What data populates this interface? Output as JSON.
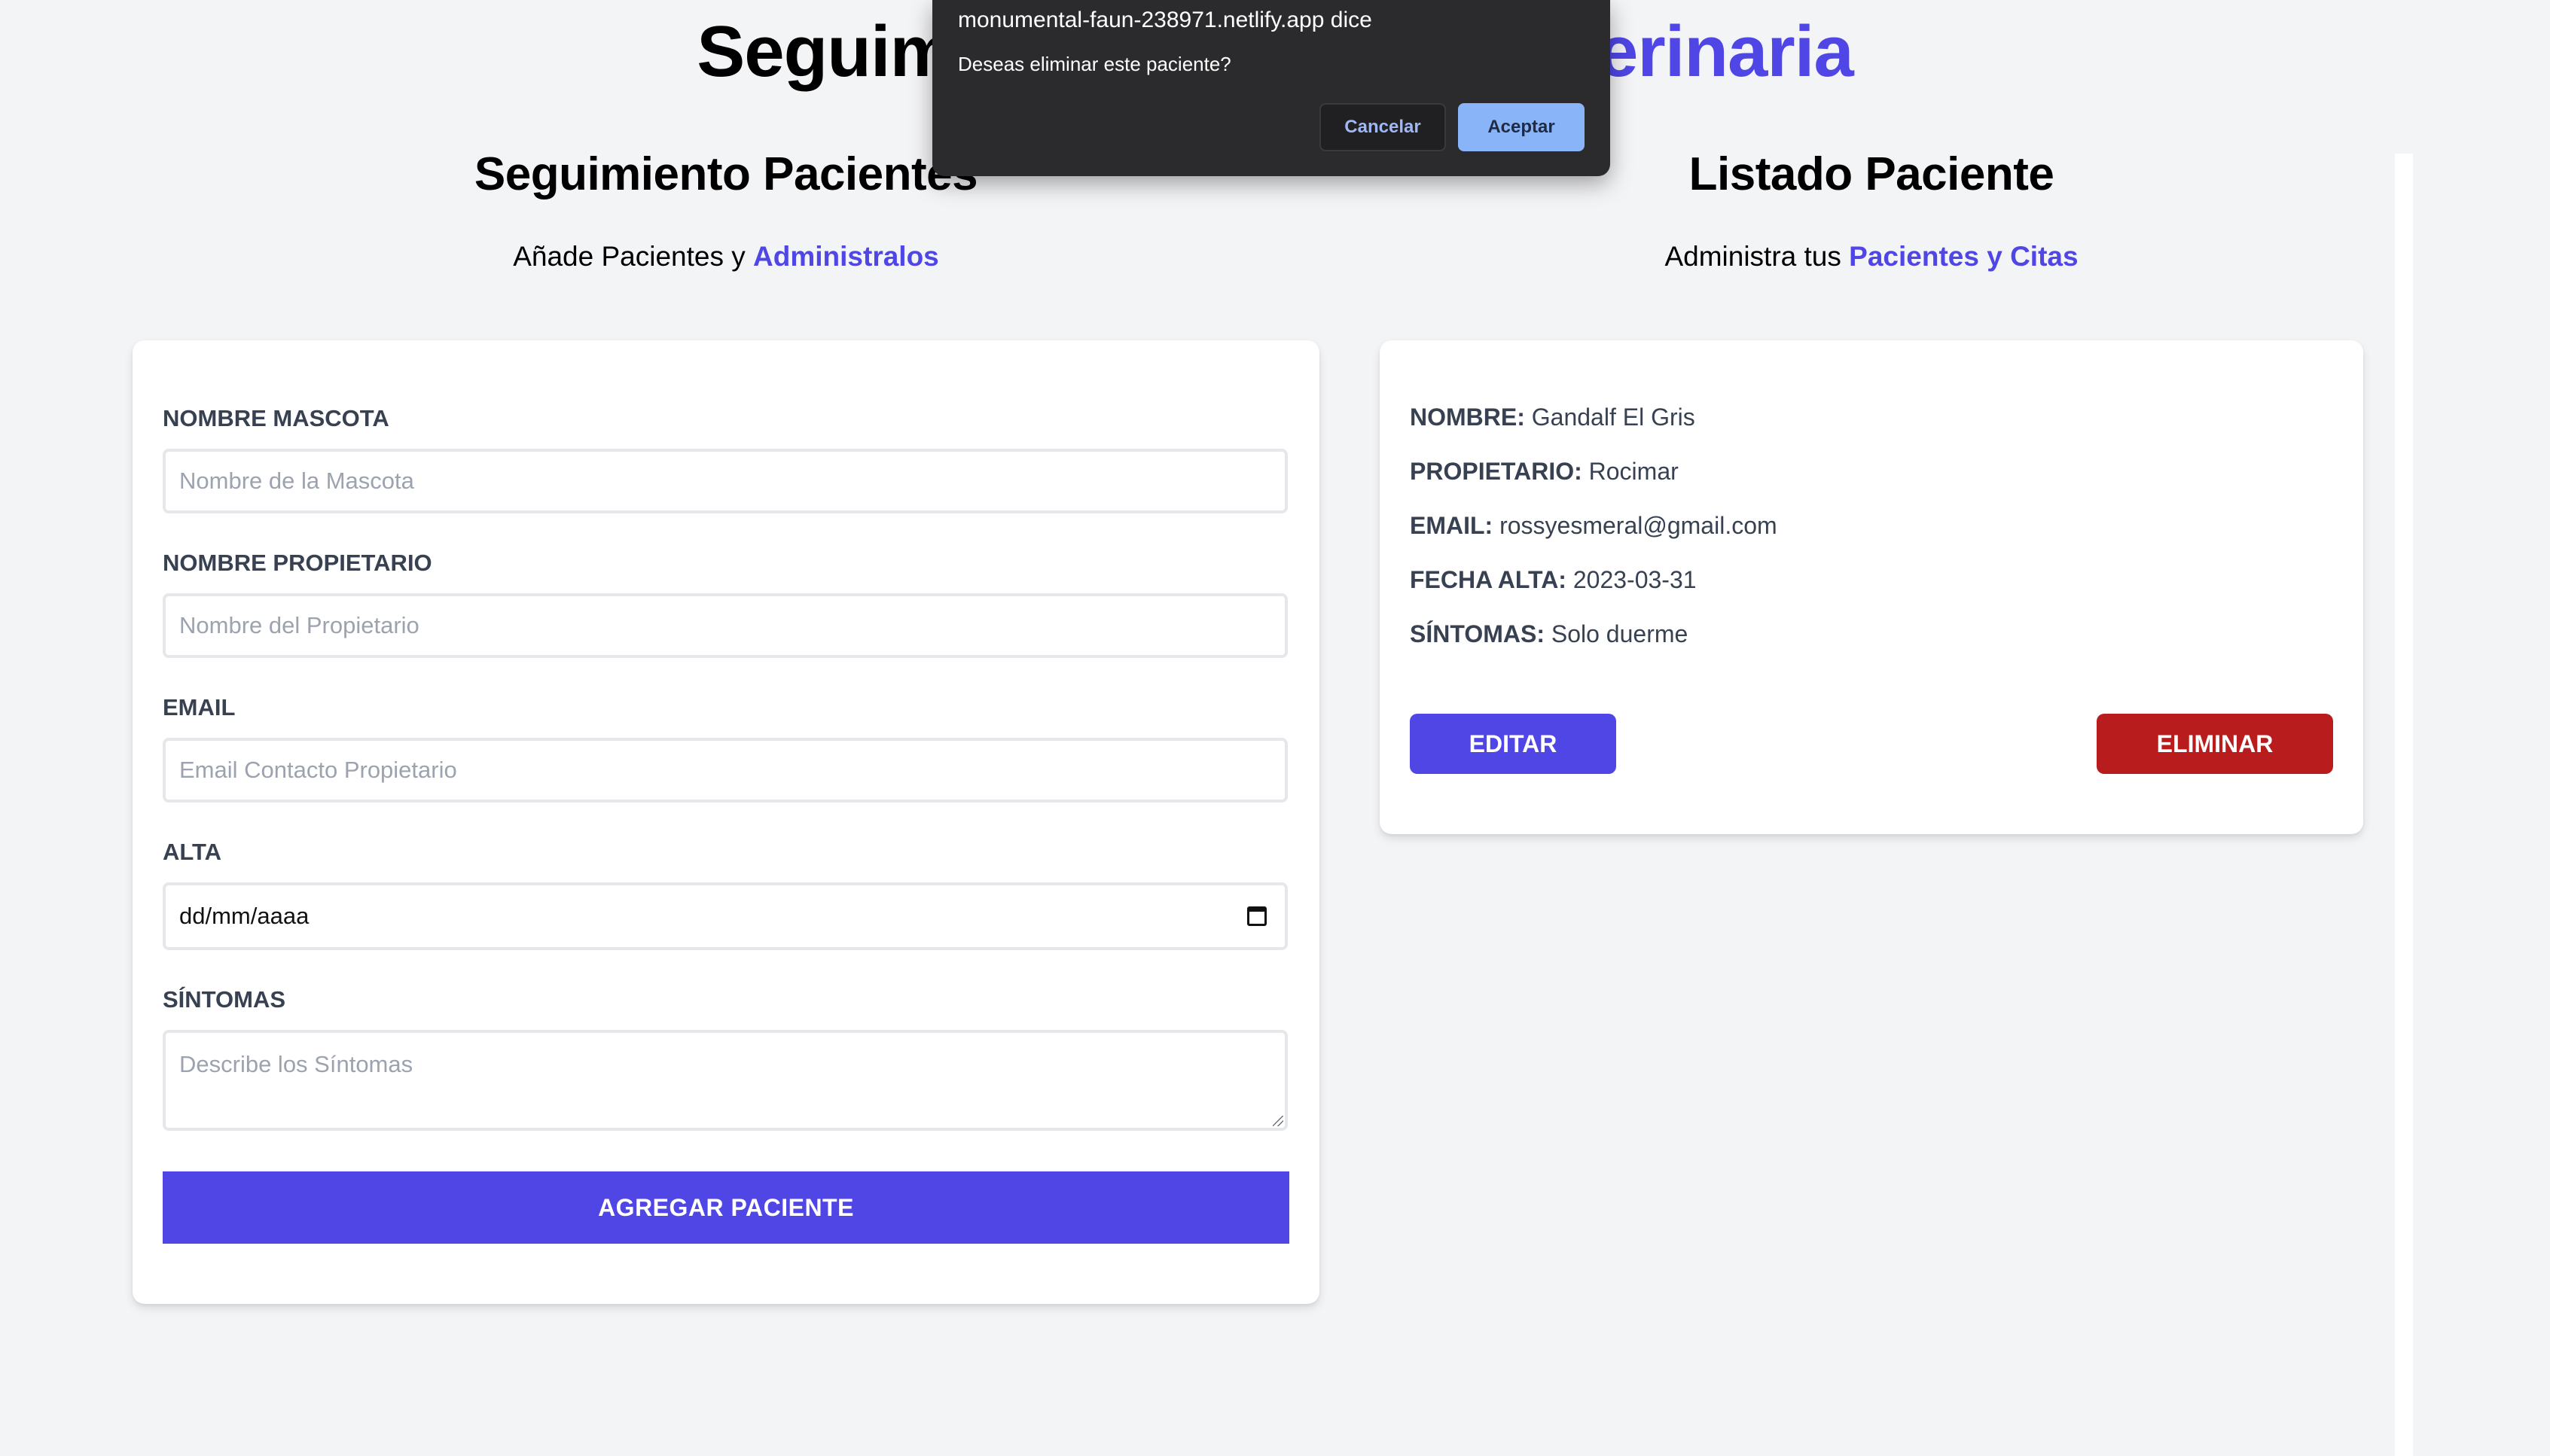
{
  "page": {
    "title_pre": "Seguimiento Pacientes ",
    "title_accent": "Veterinaria"
  },
  "form_section": {
    "heading": "Seguimiento Pacientes",
    "subtitle_pre": "Añade Pacientes y ",
    "subtitle_accent": "Administralos",
    "fields": {
      "pet_name": {
        "label": "NOMBRE MASCOTA",
        "placeholder": "Nombre de la Mascota",
        "value": ""
      },
      "owner_name": {
        "label": "NOMBRE PROPIETARIO",
        "placeholder": "Nombre del Propietario",
        "value": ""
      },
      "email": {
        "label": "EMAIL",
        "placeholder": "Email Contacto Propietario",
        "value": ""
      },
      "discharge": {
        "label": "ALTA",
        "value": "dd/mm/aaaa"
      },
      "symptoms": {
        "label": "SÍNTOMAS",
        "placeholder": "Describe los Síntomas",
        "value": ""
      }
    },
    "submit_label": "AGREGAR PACIENTE"
  },
  "list_section": {
    "heading": "Listado Paciente",
    "subtitle_pre": "Administra tus ",
    "subtitle_accent": "Pacientes y Citas",
    "patient": {
      "name_key": "NOMBRE:",
      "name_value": "Gandalf El Gris",
      "owner_key": "PROPIETARIO:",
      "owner_value": "Rocimar",
      "email_key": "EMAIL:",
      "email_value": "rossyesmeral@gmail.com",
      "date_key": "FECHA ALTA:",
      "date_value": "2023-03-31",
      "symptoms_key": "SÍNTOMAS:",
      "symptoms_value": "Solo duerme"
    },
    "edit_label": "EDITAR",
    "delete_label": "ELIMINAR"
  },
  "dialog": {
    "origin": "monumental-faun-238971.netlify.app dice",
    "message": "Deseas eliminar este paciente?",
    "cancel_label": "Cancelar",
    "accept_label": "Aceptar"
  },
  "colors": {
    "accent": "#4f46e5",
    "danger": "#b91c1c",
    "background": "#f3f4f6",
    "dialog_bg": "#2b2b2d",
    "dialog_accept": "#8ab4f8"
  }
}
